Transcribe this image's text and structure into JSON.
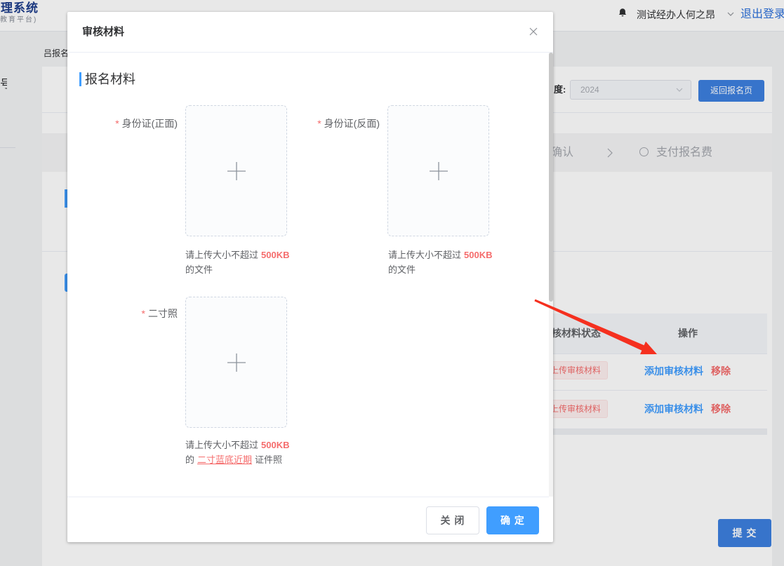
{
  "app": {
    "title": "理系统",
    "subtitle": "教育平台)"
  },
  "header": {
    "user_name": "测试经办人何之昂",
    "logout": "退出登录"
  },
  "page": {
    "breadcrumb": "吕报名",
    "title": "号",
    "year_label": "度:",
    "year_value": "2024",
    "back_button": "返回报名页",
    "steps": [
      {
        "label": "确认"
      },
      {
        "label": "支付报名费"
      }
    ],
    "table": {
      "headers": [
        "核材料状态",
        "操作"
      ],
      "rows": [
        {
          "status": "上传审核材料",
          "add_action": "添加审核材料",
          "remove_action": "移除"
        },
        {
          "status": "上传审核材料",
          "add_action": "添加审核材料",
          "remove_action": "移除"
        }
      ]
    },
    "submit_button": "提 交"
  },
  "modal": {
    "title": "审核材料",
    "section_title": "报名材料",
    "fields": [
      {
        "required_mark": "*",
        "label": "身份证(正面)",
        "hint": {
          "prefix": "请上传大小不超过",
          "size": "500KB",
          "line2": "的文件"
        }
      },
      {
        "required_mark": "*",
        "label": "身份证(反面)",
        "hint": {
          "prefix": "请上传大小不超过",
          "size": "500KB",
          "line2": "的文件"
        }
      },
      {
        "required_mark": "*",
        "label": "二寸照",
        "hint": {
          "prefix": "请上传大小不超过",
          "size": "500KB",
          "line2_prefix": "的",
          "line2_highlight": "二寸蓝底近期",
          "line2_suffix": "证件照"
        }
      }
    ],
    "cancel_button": "关 闭",
    "confirm_button": "确 定"
  },
  "icons": {
    "notification": "bell-icon",
    "user_menu": "chevron-down-icon",
    "year_select": "chevron-down-icon",
    "step_separator": "chevron-right-icon",
    "step_status": "circle-icon",
    "modal_close": "close-icon",
    "upload": "plus-icon"
  },
  "colors": {
    "primary": "#409eff",
    "primary_dark": "#3d80e0",
    "danger": "#f56c6c",
    "brand": "#1e3e8c",
    "annotation": "#f5301f",
    "overlay": "rgba(0,0,0,0.09)"
  }
}
